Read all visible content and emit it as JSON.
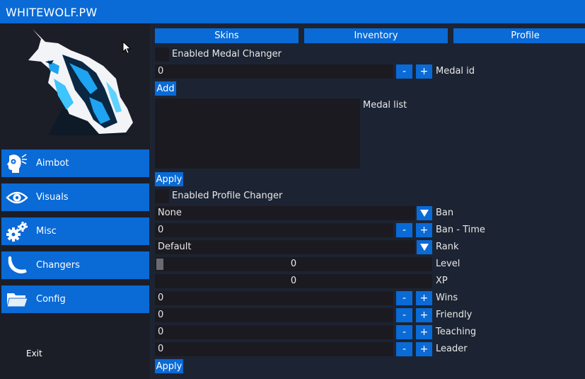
{
  "app": {
    "title": "WHITEWOLF.PW"
  },
  "sidebar": {
    "items": [
      {
        "label": "Aimbot",
        "icon": "aimbot-head-icon"
      },
      {
        "label": "Visuals",
        "icon": "eye-icon"
      },
      {
        "label": "Misc",
        "icon": "gears-icon"
      },
      {
        "label": "Changers",
        "icon": "knife-icon"
      },
      {
        "label": "Config",
        "icon": "folder-icon"
      }
    ],
    "exit_label": "Exit"
  },
  "tabs": [
    {
      "label": "Skins"
    },
    {
      "label": "Inventory"
    },
    {
      "label": "Profile"
    }
  ],
  "medal": {
    "enable_label": "Enabled Medal Changer",
    "enabled": false,
    "id_value": "0",
    "id_label": "Medal id",
    "add_label": "Add",
    "list_label": "Medal list",
    "apply_label": "Apply"
  },
  "profile": {
    "enable_label": "Enabled Profile Changer",
    "enabled": false,
    "ban_value": "None",
    "ban_label": "Ban",
    "ban_time_value": "0",
    "ban_time_label": "Ban - Time",
    "rank_value": "Default",
    "rank_label": "Rank",
    "level_value": "0",
    "level_label": "Level",
    "xp_value": "0",
    "xp_label": "XP",
    "wins_value": "0",
    "wins_label": "Wins",
    "friendly_value": "0",
    "friendly_label": "Friendly",
    "teaching_value": "0",
    "teaching_label": "Teaching",
    "leader_value": "0",
    "leader_label": "Leader",
    "apply_label": "Apply"
  },
  "spin": {
    "minus": "-",
    "plus": "+"
  },
  "colors": {
    "accent": "#0a6ad6",
    "field": "#1c1a21",
    "panel": "#1c2433",
    "sidebar": "#1b1e26"
  }
}
